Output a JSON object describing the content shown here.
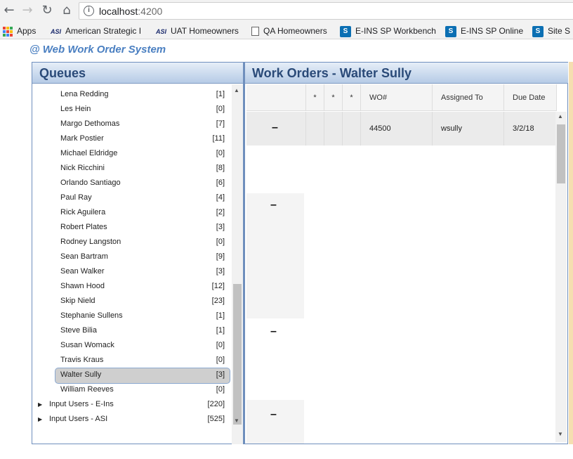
{
  "browser": {
    "url_host": "localhost",
    "url_port": ":4200",
    "back_icon": "arrow-left-icon",
    "forward_icon": "arrow-right-icon",
    "reload_icon": "reload-icon",
    "home_icon": "home-icon",
    "bookmarks": [
      {
        "label": "Apps",
        "icon": "apps-grid-icon"
      },
      {
        "label": "American Strategic I",
        "icon": "asi-logo-icon"
      },
      {
        "label": "UAT Homeowners",
        "icon": "asi-logo-icon"
      },
      {
        "label": "QA Homeowners",
        "icon": "document-icon"
      },
      {
        "label": "E-INS SP Workbench",
        "icon": "sharepoint-icon"
      },
      {
        "label": "E-INS SP Online",
        "icon": "sharepoint-icon"
      },
      {
        "label": "Site S",
        "icon": "sharepoint-icon"
      }
    ]
  },
  "app": {
    "title": "@ Web Work Order System",
    "queues_title": "Queues",
    "work_orders_title": "Work Orders - Walter Sully"
  },
  "queues": [
    {
      "name": "Lena Redding",
      "count": "[1]"
    },
    {
      "name": "Les Hein",
      "count": "[0]"
    },
    {
      "name": "Margo Dethomas",
      "count": "[7]"
    },
    {
      "name": "Mark Postier",
      "count": "[11]"
    },
    {
      "name": "Michael Eldridge",
      "count": "[0]"
    },
    {
      "name": "Nick Ricchini",
      "count": "[8]"
    },
    {
      "name": "Orlando Santiago",
      "count": "[6]"
    },
    {
      "name": "Paul Ray",
      "count": "[4]"
    },
    {
      "name": "Rick Aguilera",
      "count": "[2]"
    },
    {
      "name": "Robert Plates",
      "count": "[3]"
    },
    {
      "name": "Rodney Langston",
      "count": "[0]"
    },
    {
      "name": "Sean Bartram",
      "count": "[9]"
    },
    {
      "name": "Sean Walker",
      "count": "[3]"
    },
    {
      "name": "Shawn Hood",
      "count": "[12]"
    },
    {
      "name": "Skip Nield",
      "count": "[23]"
    },
    {
      "name": "Stephanie Sullens",
      "count": "[1]"
    },
    {
      "name": "Steve Bilia",
      "count": "[1]"
    },
    {
      "name": "Susan Womack",
      "count": "[0]"
    },
    {
      "name": "Travis Kraus",
      "count": "[0]"
    },
    {
      "name": "Walter Sully",
      "count": "[3]",
      "selected": true
    },
    {
      "name": "William Reeves",
      "count": "[0]"
    }
  ],
  "queue_groups": [
    {
      "name": "Input Users - E-Ins",
      "count": "[220]"
    },
    {
      "name": "Input Users - ASI",
      "count": "[525]"
    }
  ],
  "grid": {
    "columns": [
      "*",
      "*",
      "*",
      "WO#",
      "Assigned To",
      "Due Date"
    ],
    "rows": [
      {
        "wo": "44500",
        "assigned": "wsully",
        "due": "3/2/18"
      }
    ],
    "dash": "–"
  },
  "colors": {
    "header_gradient_top": "#e6eef8",
    "header_gradient_bottom": "#b6cbe6",
    "header_text": "#2a4a78",
    "title_accent": "#4a7fc1"
  }
}
